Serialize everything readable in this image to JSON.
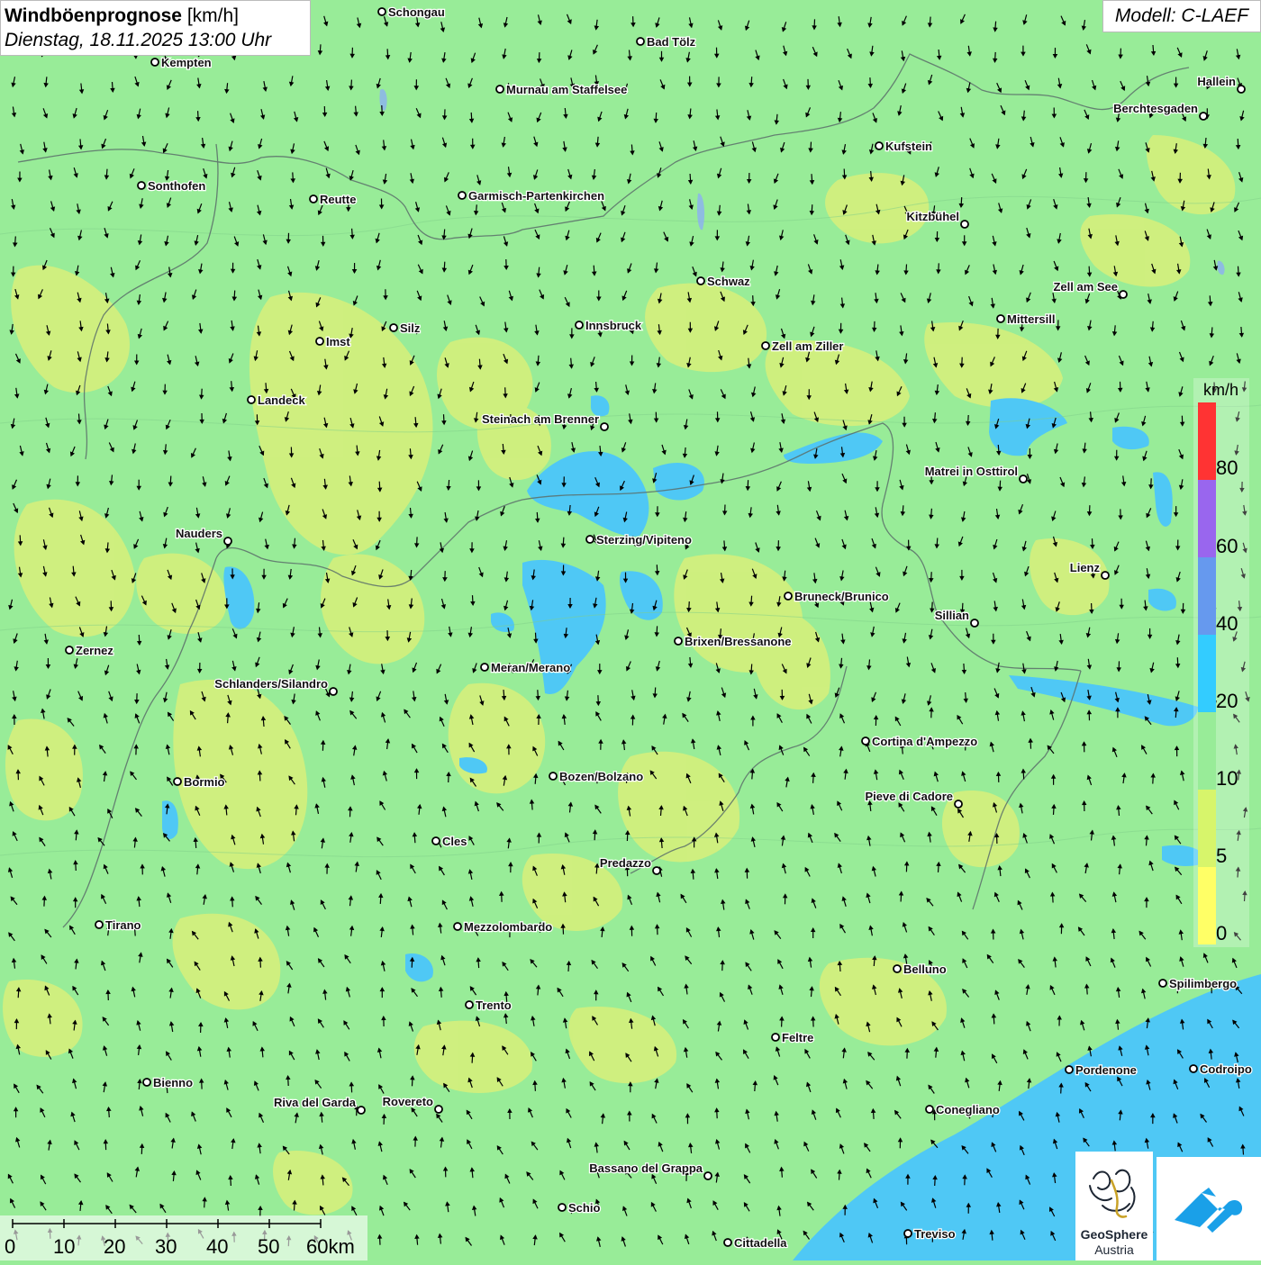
{
  "title": {
    "main": "Windböenprognose",
    "unit": "[km/h]",
    "datetime": "Dienstag, 18.11.2025 13:00 Uhr"
  },
  "model": "Modell: C-LAEF",
  "legend": {
    "unit": "km/h",
    "labels": [
      "0",
      "5",
      "10",
      "20",
      "40",
      "60",
      "80"
    ],
    "colors": [
      "#ffff66",
      "#d7f56b",
      "#98ec98",
      "#33ccff",
      "#6699ee",
      "#9966ee",
      "#ff3333"
    ]
  },
  "map_colors": {
    "background": "#98ec98",
    "light_zone": "#d8f07a",
    "strong_zone": "#4fc8f5",
    "arrows": "#000000"
  },
  "wind_direction": "mostly northerly to north-westerly flow, southerly in the south",
  "cities": [
    {
      "name": "Schongau"
    },
    {
      "name": "Bad Tölz"
    },
    {
      "name": "Kempten"
    },
    {
      "name": "Murnau am Staffelsee"
    },
    {
      "name": "Hallein"
    },
    {
      "name": "Berchtesgaden"
    },
    {
      "name": "Kufstein"
    },
    {
      "name": "Sonthofen"
    },
    {
      "name": "Reutte"
    },
    {
      "name": "Garmisch-Partenkirchen"
    },
    {
      "name": "Kitzbühel"
    },
    {
      "name": "Schwaz"
    },
    {
      "name": "Zell am See"
    },
    {
      "name": "Innsbruck"
    },
    {
      "name": "Mittersill"
    },
    {
      "name": "Silz"
    },
    {
      "name": "Imst"
    },
    {
      "name": "Zell am Ziller"
    },
    {
      "name": "Landeck"
    },
    {
      "name": "Steinach am Brenner"
    },
    {
      "name": "Matrei in Osttirol"
    },
    {
      "name": "Nauders"
    },
    {
      "name": "Sterzing/Vipiteno"
    },
    {
      "name": "Lienz"
    },
    {
      "name": "Bruneck/Brunico"
    },
    {
      "name": "Sillian"
    },
    {
      "name": "Zernez"
    },
    {
      "name": "Brixen/Bressanone"
    },
    {
      "name": "Meran/Merano"
    },
    {
      "name": "Schlanders/Silandro"
    },
    {
      "name": "Cortina d'Ampezzo"
    },
    {
      "name": "Bormio"
    },
    {
      "name": "Bozen/Bolzano"
    },
    {
      "name": "Pieve di Cadore"
    },
    {
      "name": "Cles"
    },
    {
      "name": "Predazzo"
    },
    {
      "name": "Tirano"
    },
    {
      "name": "Mezzolombardo"
    },
    {
      "name": "Belluno"
    },
    {
      "name": "Spilimbergo"
    },
    {
      "name": "Trento"
    },
    {
      "name": "Feltre"
    },
    {
      "name": "Pordenone"
    },
    {
      "name": "Codroipo"
    },
    {
      "name": "Bienno"
    },
    {
      "name": "Riva del Garda"
    },
    {
      "name": "Rovereto"
    },
    {
      "name": "Conegliano"
    },
    {
      "name": "Bassano del Grappa"
    },
    {
      "name": "Schio"
    },
    {
      "name": "Treviso"
    },
    {
      "name": "Cittadella"
    }
  ],
  "scale": {
    "labels": [
      "0",
      "10",
      "20",
      "30",
      "40",
      "50",
      "60km"
    ]
  },
  "logo": {
    "name": "GeoSphere",
    "country": "Austria"
  }
}
